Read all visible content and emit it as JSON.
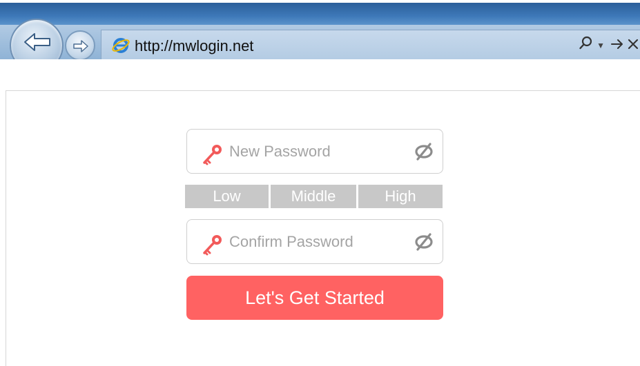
{
  "browser": {
    "url": "http://mwlogin.net",
    "icons": {
      "back": "back-arrow-icon",
      "forward": "forward-arrow-icon",
      "site": "internet-explorer-icon",
      "search": "search-icon",
      "dropdown": "dropdown-arrow-icon",
      "go": "go-arrow-icon",
      "stop": "close-icon"
    }
  },
  "form": {
    "new_password_placeholder": "New Password",
    "confirm_password_placeholder": "Confirm Password",
    "strength": {
      "low": "Low",
      "middle": "Middle",
      "high": "High"
    },
    "submit_label": "Let's Get Started"
  },
  "colors": {
    "accent": "#ff6262",
    "key_icon": "#f25a5a",
    "strength_inactive": "#c8c8c8"
  }
}
